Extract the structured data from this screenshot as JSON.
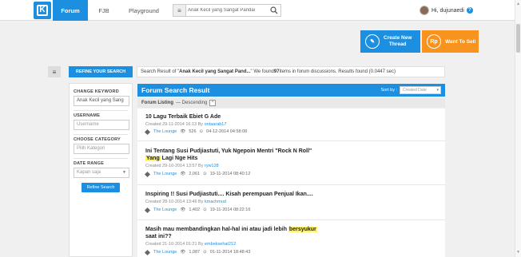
{
  "nav": {
    "tabs": [
      {
        "label": "Forum"
      },
      {
        "label": "FJB"
      },
      {
        "label": "Playground"
      }
    ],
    "search_value": "Anak Kecil yang Sangat Pandai",
    "username": "Hi, dujunaedi"
  },
  "actions": {
    "create_thread_line1": "Create New",
    "create_thread_line2": "Thread",
    "want_to_sell": "Want To Sell"
  },
  "refine": {
    "header": "REFINE YOUR SEARCH",
    "keyword_label": "CHANGE KEYWORD",
    "keyword_value": "Anak Kecil yang Sang",
    "username_label": "USERNAME",
    "username_placeholder": "Username",
    "category_label": "CHOOSE CATEGORY",
    "category_placeholder": "Pilih Kategori",
    "date_label": "DATE RANGE",
    "date_value": "Kapan saja",
    "button": "Refine Search"
  },
  "summary": {
    "prefix": "Search Result of \"",
    "query": "Anak Kecil yang Sangat Pand...",
    "middle": "\" We found ",
    "count": "97",
    "suffix": " items in forum discussions. Results found (0.0447 sec)"
  },
  "results": {
    "title": "Forum Search Result",
    "sort_label": "Sort by :",
    "sort_value": "Created Date",
    "listing_label": "Forum Listing",
    "listing_order": " — Descending",
    "items": [
      {
        "title_pre": "10 Lagu Terbaik Ebiet G Ade",
        "created": "Created 29-11-2014 16:13 By ",
        "author": "ontaarab17",
        "forum": "The Lounge",
        "views": "526",
        "last": "04-12-2014 04:58:08"
      },
      {
        "title_pre": "Ini Tentang Susi Pudjiastuti, Yuk Ngepoin Mentri \"Rock N Roll\"",
        "title_hl": "Yang",
        "title_post": " Lagi Nge Hits",
        "created": "Created 29-10-2014 13:57 By ",
        "author": "ryw128",
        "forum": "The Lounge",
        "views": "2,061",
        "last": "19-11-2014 08:40:12"
      },
      {
        "title_pre": "Inspiring !! Susi Pudjiastuti.... Kisah perempuan Penjual Ikan....",
        "created": "Created 28-10-2014 13:46 By ",
        "author": "kmachmud",
        "forum": "The Lounge",
        "views": "1,402",
        "last": "19-11-2014 08:22:16"
      },
      {
        "title_pre": "Masih mau membandingkan hal-hal ini atau jadi lebih ",
        "title_hl": "bersyukur",
        "title_post2": "saat ini??",
        "created": "Created 21-10-2014 01:21 By ",
        "author": "embeksehat212",
        "forum": "The Lounge",
        "views": "1,087",
        "last": "01-11-2014 18:48:43"
      }
    ]
  },
  "colors": {
    "brand_blue": "#1d8fe1",
    "sell_orange": "#f7931e",
    "highlight": "#fff36b"
  }
}
